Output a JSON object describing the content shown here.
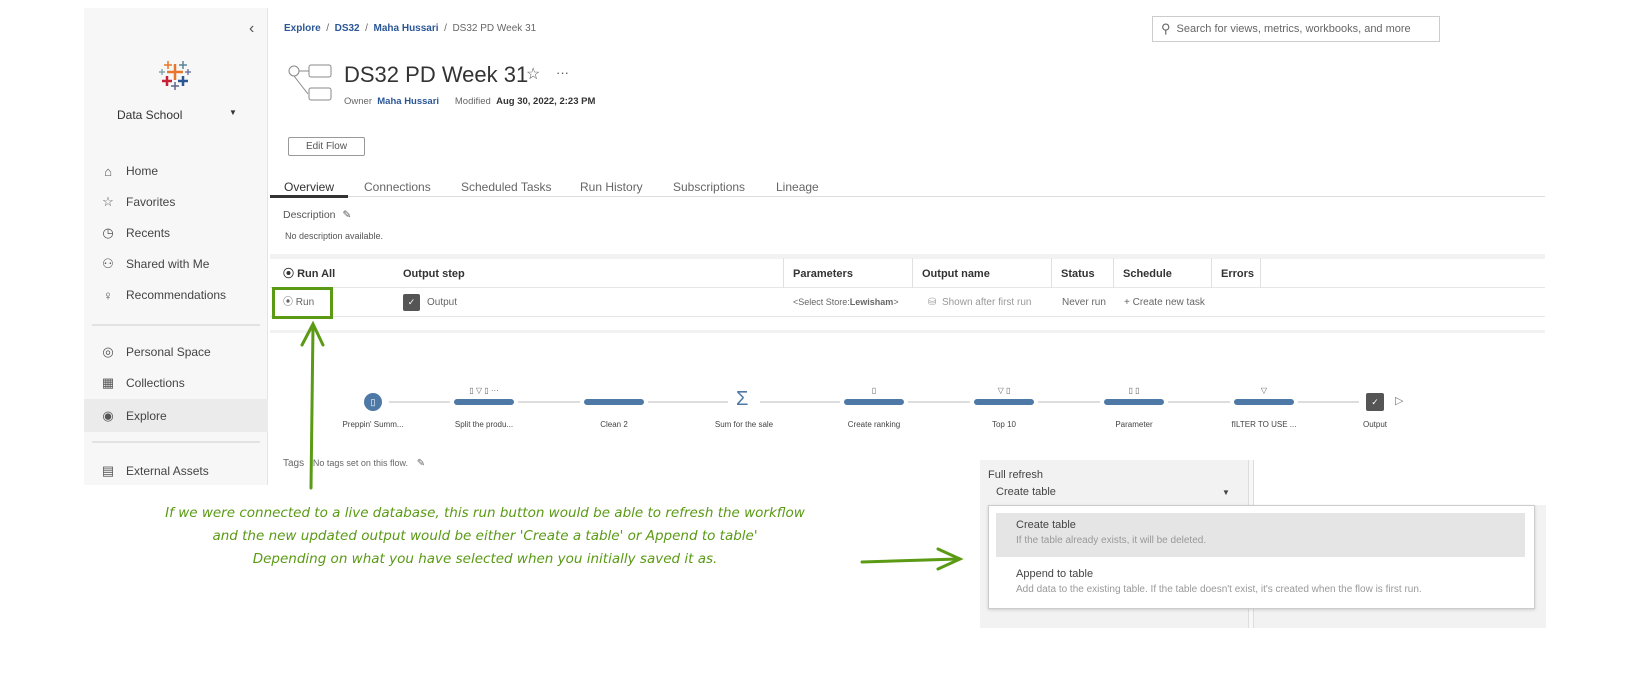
{
  "sidebar": {
    "site": "Data School",
    "items": [
      {
        "label": "Home",
        "icon": "home-icon"
      },
      {
        "label": "Favorites",
        "icon": "star-icon"
      },
      {
        "label": "Recents",
        "icon": "clock-icon"
      },
      {
        "label": "Shared with Me",
        "icon": "shared-icon"
      },
      {
        "label": "Recommendations",
        "icon": "lightbulb-icon"
      },
      {
        "label": "Personal Space",
        "icon": "user-icon"
      },
      {
        "label": "Collections",
        "icon": "collections-icon"
      },
      {
        "label": "Explore",
        "icon": "compass-icon",
        "active": true
      },
      {
        "label": "External Assets",
        "icon": "database-icon"
      }
    ]
  },
  "breadcrumb": [
    "Explore",
    "DS32",
    "Maha Hussari",
    "DS32 PD Week 31"
  ],
  "search": {
    "placeholder": "Search for views, metrics, workbooks, and more"
  },
  "header": {
    "title": "DS32 PD Week 31",
    "owner_label": "Owner",
    "owner": "Maha Hussari",
    "modified_label": "Modified",
    "modified": "Aug 30, 2022, 2:23 PM",
    "more": "···"
  },
  "edit_flow": "Edit Flow",
  "tabs": [
    "Overview",
    "Connections",
    "Scheduled Tasks",
    "Run History",
    "Subscriptions",
    "Lineage"
  ],
  "description": {
    "label": "Description",
    "value": "No description available."
  },
  "table": {
    "headers": [
      "Run All",
      "Output step",
      "Parameters",
      "Output name",
      "Status",
      "Schedule",
      "Errors"
    ],
    "row": {
      "run": "Run",
      "output_step": "Output",
      "parameters_prefix": "<Select Store:",
      "parameters_value": "Lewisham",
      "parameters_suffix": ">",
      "output_name": "Shown after first run",
      "status": "Never run",
      "schedule": "+ Create new task",
      "errors": ""
    }
  },
  "flow": {
    "steps": [
      "Preppin' Summ...",
      "Split the produ...",
      "Clean 2",
      "Sum for the sale",
      "Create ranking",
      "Top 10",
      "Parameter",
      "fILTER TO USE ...",
      "Output"
    ],
    "accent": "#4e79a7"
  },
  "tags": {
    "label": "Tags",
    "value": "No tags set on this flow."
  },
  "annotation": {
    "lines": [
      "If we were connected to a live database, this run button would be able to refresh the workflow",
      "and the new updated output would be either 'Create a table' or Append to table'",
      "Depending on what you have selected when you initially saved it as."
    ],
    "color": "#5a9a14"
  },
  "refresh": {
    "label": "Full refresh",
    "selected": "Create table",
    "options": [
      {
        "title": "Create table",
        "desc": "If the table already exists, it will be deleted."
      },
      {
        "title": "Append to table",
        "desc": "Add data to the existing table. If the table doesn't exist, it's created when the flow is first run."
      }
    ]
  }
}
